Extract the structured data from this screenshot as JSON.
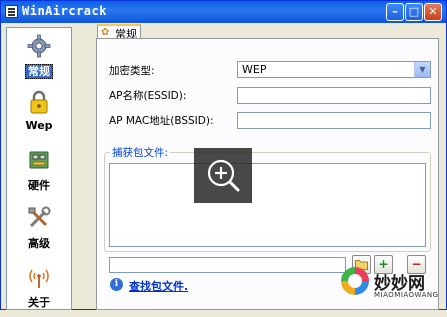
{
  "window": {
    "title": "WinAircrack"
  },
  "sidebar": {
    "items": [
      {
        "label": "常规",
        "icon": "gear-icon",
        "active": true
      },
      {
        "label": "Wep",
        "icon": "padlock-icon",
        "active": false
      },
      {
        "label": "硬件",
        "icon": "hardware-card-icon",
        "active": false
      },
      {
        "label": "高级",
        "icon": "tools-icon",
        "active": false
      },
      {
        "label": "关于",
        "icon": "antenna-icon",
        "active": false
      }
    ]
  },
  "tab": {
    "label": "常规"
  },
  "form": {
    "encryption_label": "加密类型:",
    "encryption_value": "WEP",
    "essid_label": "AP名称(ESSID):",
    "essid_value": "",
    "bssid_label": "AP MAC地址(BSSID):",
    "bssid_value": "",
    "capture_group_label": "捕获包文件:",
    "capture_files": [],
    "path_value": "",
    "find_link": "查找包文件."
  },
  "colors": {
    "titlebar": "#0A5FE8",
    "selected": "#316AC5",
    "link": "#0033CC"
  },
  "watermark": {
    "cn": "妙妙网",
    "en": "MIAOMIAOWANG"
  }
}
